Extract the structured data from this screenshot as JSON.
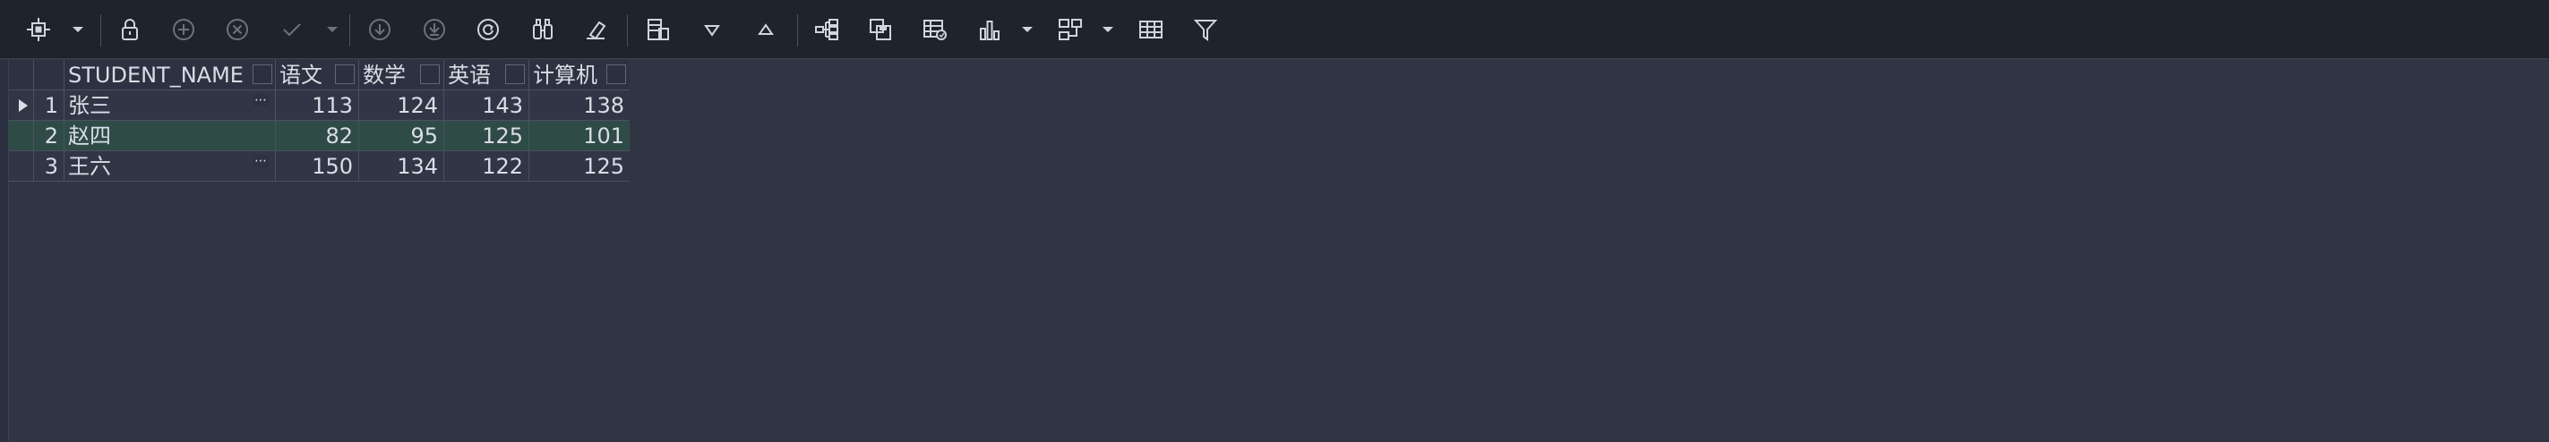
{
  "toolbar": {
    "items": [
      {
        "name": "grid-settings-icon",
        "enabled": true
      },
      {
        "name": "lock-icon",
        "enabled": true
      },
      {
        "name": "add-row-icon",
        "enabled": false
      },
      {
        "name": "delete-row-icon",
        "enabled": false
      },
      {
        "name": "commit-icon",
        "enabled": false
      },
      {
        "name": "fetch-next-icon",
        "enabled": false
      },
      {
        "name": "fetch-all-icon",
        "enabled": false
      },
      {
        "name": "refresh-icon",
        "enabled": true
      },
      {
        "name": "find-icon",
        "enabled": true
      },
      {
        "name": "clear-icon",
        "enabled": false
      },
      {
        "name": "single-record-view-icon",
        "enabled": true
      },
      {
        "name": "sort-ascending-icon",
        "enabled": true
      },
      {
        "name": "sort-descending-icon",
        "enabled": true
      },
      {
        "name": "group-by-icon",
        "enabled": true
      },
      {
        "name": "save-to-file-icon",
        "enabled": true
      },
      {
        "name": "export-grid-icon",
        "enabled": true
      },
      {
        "name": "bar-chart-icon",
        "enabled": true
      },
      {
        "name": "pivot-icon",
        "enabled": true
      },
      {
        "name": "table-view-icon",
        "enabled": true
      },
      {
        "name": "filter-icon",
        "enabled": true
      }
    ]
  },
  "grid": {
    "columns": [
      {
        "key": "STUDENT_NAME",
        "label": "STUDENT_NAME"
      },
      {
        "key": "语文",
        "label": "语文"
      },
      {
        "key": "数学",
        "label": "数学"
      },
      {
        "key": "英语",
        "label": "英语"
      },
      {
        "key": "计算机",
        "label": "计算机"
      }
    ],
    "rows": [
      {
        "index": "1",
        "STUDENT_NAME": "张三",
        "语文": "113",
        "数学": "124",
        "英语": "143",
        "计算机": "138",
        "current": true,
        "selected": false
      },
      {
        "index": "2",
        "STUDENT_NAME": "赵四",
        "语文": "82",
        "数学": "95",
        "英语": "125",
        "计算机": "101",
        "current": false,
        "selected": true
      },
      {
        "index": "3",
        "STUDENT_NAME": "王六",
        "语文": "150",
        "数学": "134",
        "英语": "122",
        "计算机": "125",
        "current": false,
        "selected": false
      }
    ],
    "ellipsis_label": "⋯"
  },
  "colors": {
    "toolbar_bg": "#1f232b",
    "background": "#2f3542",
    "grid_bg": "#303645",
    "selected_row": "#2f4b46",
    "grid_line": "#4a5161",
    "text": "#d9dde5",
    "icon": "#cfd5df",
    "icon_disabled": "#6b7280"
  }
}
